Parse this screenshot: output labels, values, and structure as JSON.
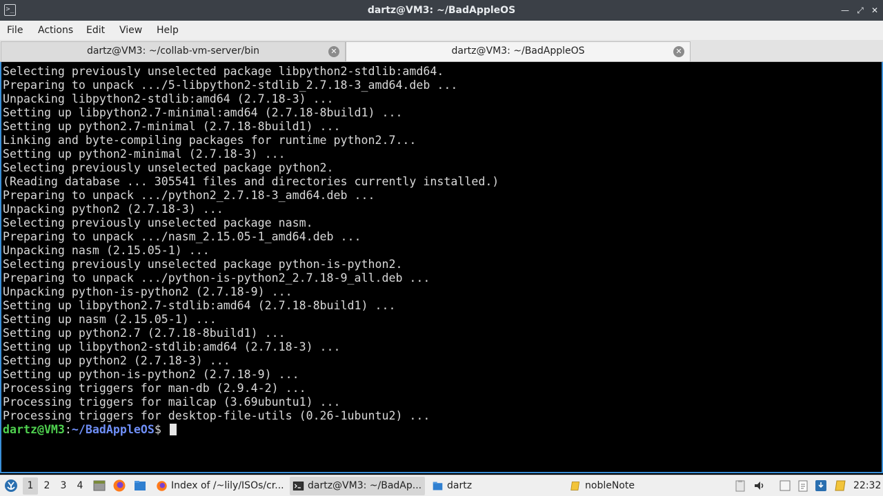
{
  "window": {
    "title": "dartz@VM3: ~/BadAppleOS",
    "minimize_icon": "minimize-icon",
    "maximize_icon": "restore-icon",
    "close_icon": "close-icon"
  },
  "menu": {
    "file": "File",
    "actions": "Actions",
    "edit": "Edit",
    "view": "View",
    "help": "Help"
  },
  "tabs": [
    {
      "label": "dartz@VM3: ~/collab-vm-server/bin",
      "active": false
    },
    {
      "label": "dartz@VM3: ~/BadAppleOS",
      "active": true
    }
  ],
  "terminal": {
    "lines": [
      "Selecting previously unselected package libpython2-stdlib:amd64.",
      "Preparing to unpack .../5-libpython2-stdlib_2.7.18-3_amd64.deb ...",
      "Unpacking libpython2-stdlib:amd64 (2.7.18-3) ...",
      "Setting up libpython2.7-minimal:amd64 (2.7.18-8build1) ...",
      "Setting up python2.7-minimal (2.7.18-8build1) ...",
      "Linking and byte-compiling packages for runtime python2.7...",
      "Setting up python2-minimal (2.7.18-3) ...",
      "Selecting previously unselected package python2.",
      "(Reading database ... 305541 files and directories currently installed.)",
      "Preparing to unpack .../python2_2.7.18-3_amd64.deb ...",
      "Unpacking python2 (2.7.18-3) ...",
      "Selecting previously unselected package nasm.",
      "Preparing to unpack .../nasm_2.15.05-1_amd64.deb ...",
      "Unpacking nasm (2.15.05-1) ...",
      "Selecting previously unselected package python-is-python2.",
      "Preparing to unpack .../python-is-python2_2.7.18-9_all.deb ...",
      "Unpacking python-is-python2 (2.7.18-9) ...",
      "Setting up libpython2.7-stdlib:amd64 (2.7.18-8build1) ...",
      "Setting up nasm (2.15.05-1) ...",
      "Setting up python2.7 (2.7.18-8build1) ...",
      "Setting up libpython2-stdlib:amd64 (2.7.18-3) ...",
      "Setting up python2 (2.7.18-3) ...",
      "Setting up python-is-python2 (2.7.18-9) ...",
      "Processing triggers for man-db (2.9.4-2) ...",
      "Processing triggers for mailcap (3.69ubuntu1) ...",
      "Processing triggers for desktop-file-utils (0.26-1ubuntu2) ..."
    ],
    "prompt_user": "dartz@VM3",
    "prompt_colon": ":",
    "prompt_path": "~/BadAppleOS",
    "prompt_symbol": "$"
  },
  "taskbar": {
    "workspaces": [
      "1",
      "2",
      "3",
      "4"
    ],
    "current_workspace": "1",
    "tasks": [
      {
        "label": "Index of /~lily/ISOs/cr...",
        "icon": "firefox-icon"
      },
      {
        "label": "dartz@VM3: ~/BadAp...",
        "icon": "terminal-icon",
        "active": true
      },
      {
        "label": "dartz",
        "icon": "folder-icon"
      },
      {
        "label": "nobleNote",
        "icon": "note-icon"
      }
    ],
    "clock": "22:32"
  },
  "colors": {
    "terminal_bg": "#000000",
    "terminal_fg": "#d9d9d9",
    "prompt_user": "#4fd14f",
    "prompt_path": "#6f8ff7",
    "title_bar": "#3b4047",
    "focus_border": "#3a8fd8"
  }
}
